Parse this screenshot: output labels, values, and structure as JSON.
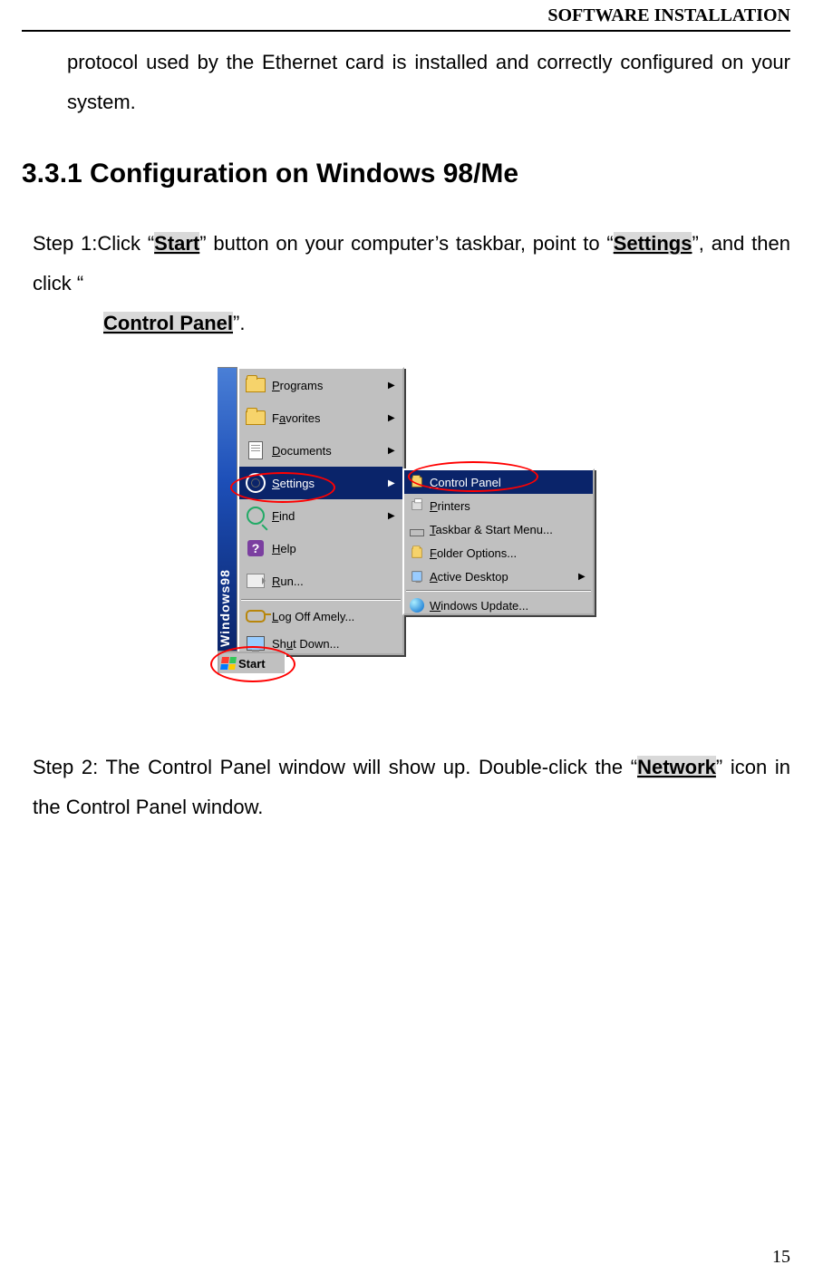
{
  "header": {
    "title": "SOFTWARE INSTALLATION"
  },
  "intro_text": "protocol used by the Ethernet card is installed and correctly configured on your system.",
  "section_heading": "3.3.1 Configuration on Windows 98/Me",
  "step1": {
    "prefix": "Step 1:Click “",
    "hl1": "Start",
    "mid1": "” button on your computer’s taskbar, point to “",
    "hl2": "Settings",
    "mid2": "”, and then click “",
    "hl3": "Control Panel",
    "suffix": "”."
  },
  "step2": {
    "prefix": "Step 2: The Control Panel window will show up. Double-click the “",
    "hl1": "Network",
    "suffix": "” icon in the Control Panel window."
  },
  "start_menu": {
    "band": "Windows98",
    "items": [
      {
        "label_pre": "",
        "ul": "P",
        "label_post": "rograms",
        "arrow": true,
        "icon": "programs"
      },
      {
        "label_pre": "F",
        "ul": "a",
        "label_post": "vorites",
        "arrow": true,
        "icon": "favorites"
      },
      {
        "label_pre": "",
        "ul": "D",
        "label_post": "ocuments",
        "arrow": true,
        "icon": "documents"
      },
      {
        "label_pre": "",
        "ul": "S",
        "label_post": "ettings",
        "arrow": true,
        "icon": "settings",
        "selected": true
      },
      {
        "label_pre": "",
        "ul": "F",
        "label_post": "ind",
        "arrow": true,
        "icon": "find"
      },
      {
        "label_pre": "",
        "ul": "H",
        "label_post": "elp",
        "arrow": false,
        "icon": "help"
      },
      {
        "label_pre": "",
        "ul": "R",
        "label_post": "un...",
        "arrow": false,
        "icon": "run"
      },
      {
        "label_pre": "",
        "ul": "L",
        "label_post": "og Off Amely...",
        "arrow": false,
        "icon": "logoff",
        "sep_before": true
      },
      {
        "label_pre": "Sh",
        "ul": "u",
        "label_post": "t Down...",
        "arrow": false,
        "icon": "shutdown"
      }
    ],
    "start_label": "Start"
  },
  "settings_submenu": {
    "items": [
      {
        "label_pre": "",
        "ul": "C",
        "label_post": "ontrol Panel",
        "arrow": false,
        "icon": "cp",
        "selected": true
      },
      {
        "label_pre": "",
        "ul": "P",
        "label_post": "rinters",
        "arrow": false,
        "icon": "printers"
      },
      {
        "label_pre": "",
        "ul": "T",
        "label_post": "askbar & Start Menu...",
        "arrow": false,
        "icon": "taskbar"
      },
      {
        "label_pre": "",
        "ul": "F",
        "label_post": "older Options...",
        "arrow": false,
        "icon": "folderopt"
      },
      {
        "label_pre": "",
        "ul": "A",
        "label_post": "ctive Desktop",
        "arrow": true,
        "icon": "active"
      },
      {
        "label_pre": "",
        "ul": "W",
        "label_post": "indows Update...",
        "arrow": false,
        "icon": "update",
        "sep_before": true
      }
    ]
  },
  "page_number": "15"
}
